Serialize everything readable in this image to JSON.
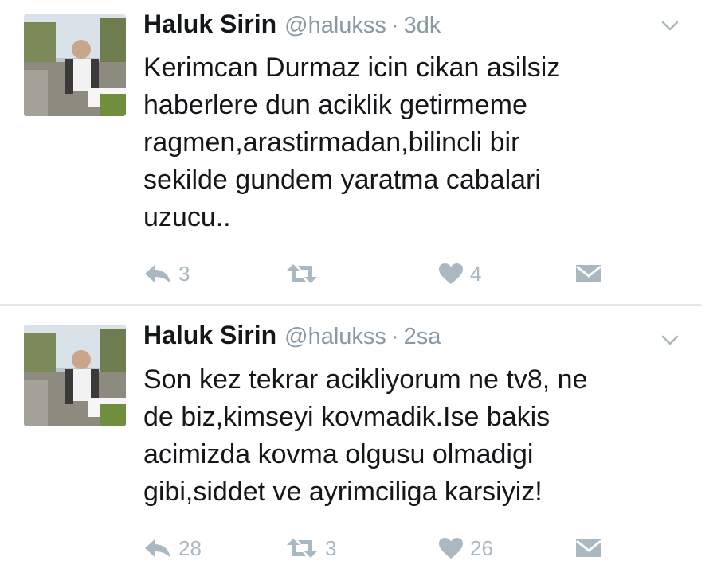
{
  "tweets": [
    {
      "author_name": "Haluk Sirin",
      "handle": "@halukss",
      "separator": "·",
      "time": "3dk",
      "text": "Kerimcan Durmaz icin cikan  asilsiz\nhaberlere dun aciklik getirmeme\nragmen,arastirmadan,bilincli bir\nsekilde gundem yaratma cabalari\nuzucu..",
      "reply_count": "3",
      "retweet_count": "",
      "like_count": "4"
    },
    {
      "author_name": "Haluk Sirin",
      "handle": "@halukss",
      "separator": "·",
      "time": "2sa",
      "text": "Son kez tekrar acikliyorum ne tv8, ne\nde biz,kimseyi kovmadik.Ise bakis\nacimizda kovma olgusu olmadigi\ngibi,siddet ve ayrimciliga karsiyiz!",
      "reply_count": "28",
      "retweet_count": "3",
      "like_count": "26"
    }
  ],
  "colors": {
    "name": "#14171a",
    "meta": "#8899a6",
    "icon": "#aab8c2",
    "divider": "#e1e8ed"
  },
  "icons": [
    "chevron-down-icon",
    "reply-icon",
    "retweet-icon",
    "like-icon",
    "message-icon"
  ]
}
